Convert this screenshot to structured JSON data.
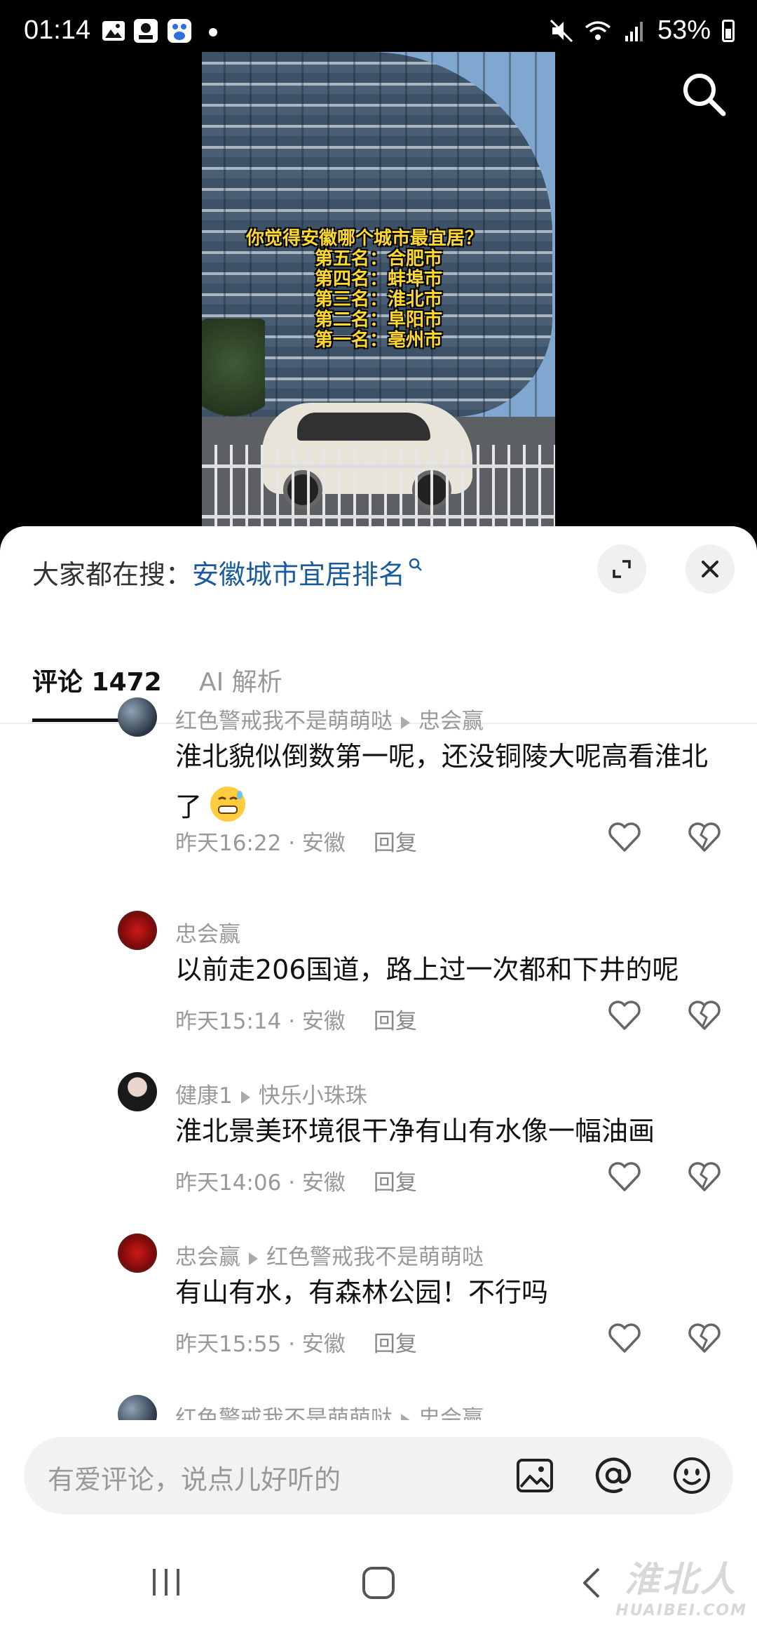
{
  "status_bar": {
    "time": "01:14",
    "battery": "53%"
  },
  "video": {
    "overlay_lines": [
      "你觉得安徽哪个城市最宜居？",
      "第五名：合肥市",
      "第四名：蚌埠市",
      "第三名：淮北市",
      "第二名：阜阳市",
      "第一名：亳州市"
    ]
  },
  "sheet": {
    "hot_search_label": "大家都在搜：",
    "hot_search_query": "安徽城市宜居排名",
    "tabs": [
      {
        "label": "评论 1472",
        "active": true
      },
      {
        "label": "AI 解析",
        "active": false
      }
    ],
    "reply_label": "回复",
    "comments": [
      {
        "user": "红色警戒我不是萌萌哒",
        "reply_to": "忠会赢",
        "text": "淮北貌似倒数第一呢，还没铜陵大呢高看淮北了",
        "emoji": "sweat-smile-emoji",
        "meta": "昨天16:22 · 安徽"
      },
      {
        "user": "忠会赢",
        "reply_to": "",
        "text": "以前走206国道，路上过一次都和下井的呢",
        "meta": "昨天15:14 · 安徽"
      },
      {
        "user": "健康1",
        "reply_to": "快乐小珠珠",
        "text": "淮北景美环境很干净有山有水像一幅油画",
        "meta": "昨天14:06 · 安徽"
      },
      {
        "user": "忠会赢",
        "reply_to": "红色警戒我不是萌萌哒",
        "text": "有山有水，有森林公园！不行吗",
        "meta": "昨天15:55 · 安徽"
      },
      {
        "user": "红色警戒我不是萌萌哒",
        "reply_to": "忠会赢",
        "text": "",
        "meta": ""
      }
    ]
  },
  "input_bar": {
    "placeholder": "有爱评论，说点儿好听的"
  },
  "watermark": {
    "cn": "淮北人",
    "en": "HUAIBEI.COM"
  },
  "colors": {
    "link": "#1b5a9c",
    "overlay_text": "#ffd92e"
  }
}
